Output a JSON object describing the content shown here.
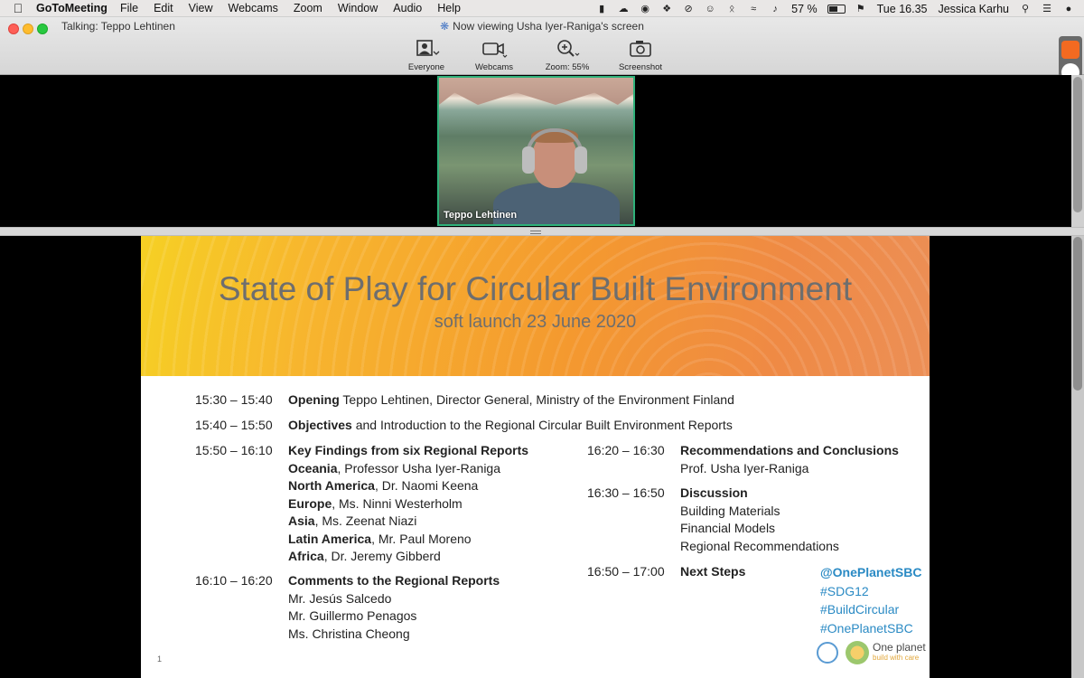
{
  "menubar": {
    "app": "GoToMeeting",
    "items": [
      "File",
      "Edit",
      "View",
      "Webcams",
      "Zoom",
      "Window",
      "Audio",
      "Help"
    ],
    "battery": "57 %",
    "clock": "Tue 16.35",
    "user": "Jessica Karhu"
  },
  "window": {
    "talking": "Talking: Teppo Lehtinen",
    "viewing": "Now viewing Usha Iyer-Raniga's screen",
    "tools": {
      "everyone": "Everyone",
      "webcams": "Webcams",
      "zoom": "Zoom: 55%",
      "screenshot": "Screenshot"
    }
  },
  "webcam": {
    "name": "Teppo Lehtinen"
  },
  "slide": {
    "title": "State of Play for Circular Built Environment",
    "subtitle": "soft launch 23 June 2020",
    "page": "1",
    "logo_text": "One planet",
    "logo_tag": "build with care",
    "left": {
      "r1": {
        "time": "15:30 – 15:40",
        "bold": "Opening",
        "rest": " Teppo Lehtinen, Director General, Ministry of the Environment Finland"
      },
      "r2": {
        "time": "15:40 – 15:50",
        "bold": "Objectives",
        "rest": " and Introduction to the Regional Circular Built Environment Reports"
      },
      "r3": {
        "time": "15:50 – 16:10",
        "bold": "Key Findings from six Regional Reports"
      },
      "regions": [
        {
          "bold": "Oceania",
          "rest": ", Professor Usha Iyer-Raniga"
        },
        {
          "bold": "North America",
          "rest": ", Dr. Naomi Keena"
        },
        {
          "bold": "Europe",
          "rest": ", Ms. Ninni Westerholm"
        },
        {
          "bold": "Asia",
          "rest": ", Ms. Zeenat Niazi"
        },
        {
          "bold": "Latin America",
          "rest": ", Mr. Paul Moreno"
        },
        {
          "bold": "Africa",
          "rest": ", Dr. Jeremy Gibberd"
        }
      ],
      "r4": {
        "time": "16:10 – 16:20",
        "bold": "Comments to the Regional Reports"
      },
      "commenters": [
        "Mr. Jesús Salcedo",
        "Mr. Guillermo Penagos",
        "Ms. Christina Cheong"
      ]
    },
    "right": {
      "r1": {
        "time": "16:20 – 16:30",
        "bold": "Recommendations and Conclusions",
        "sub": "Prof. Usha Iyer-Raniga"
      },
      "r2": {
        "time": "16:30 – 16:50",
        "bold": "Discussion",
        "subs": [
          "Building Materials",
          "Financial Models",
          "Regional Recommendations"
        ]
      },
      "r3": {
        "time": "16:50 – 17:00",
        "bold": "Next Steps"
      }
    },
    "hashtags": [
      "@OnePlanetSBC",
      "#SDG12",
      "#BuildCircular",
      "#OnePlanetSBC"
    ]
  }
}
